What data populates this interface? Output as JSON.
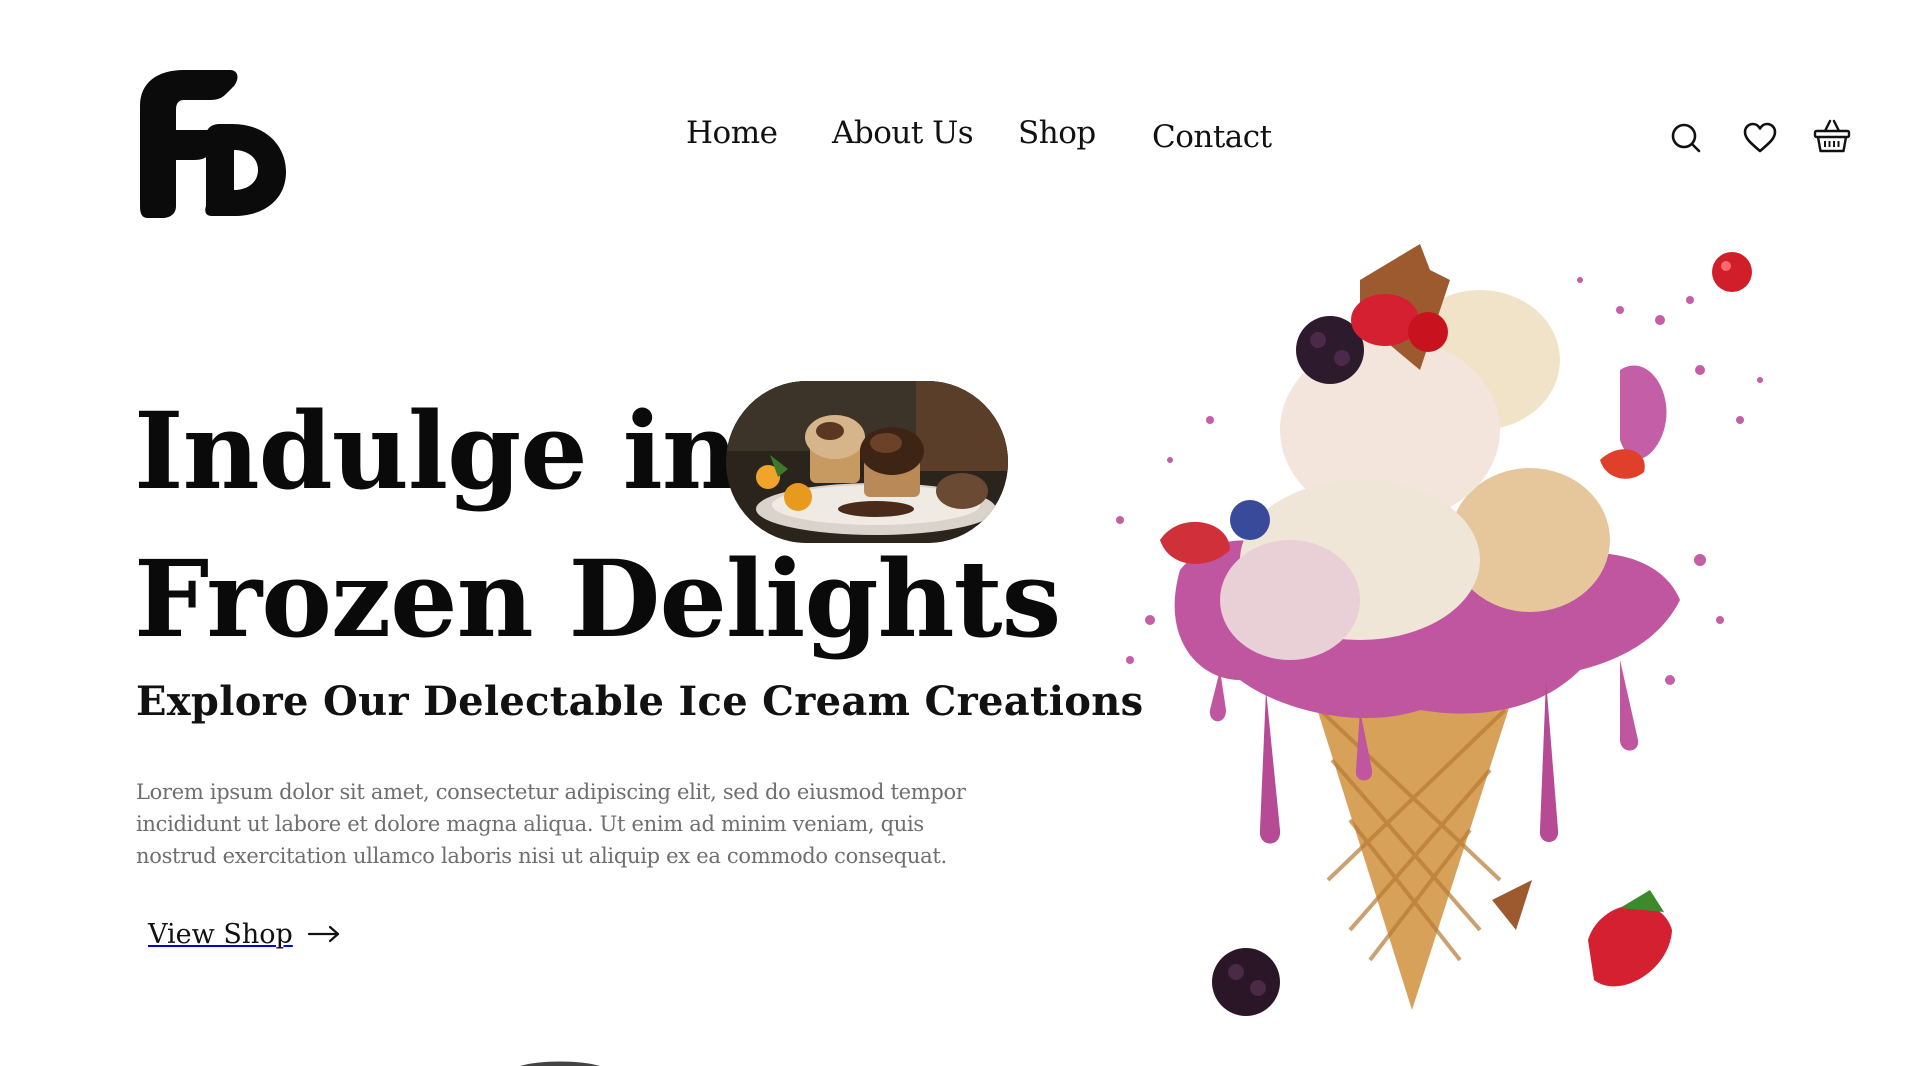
{
  "logo": {
    "icon": "fd-monogram-logo"
  },
  "nav": {
    "items": [
      {
        "label": "Home"
      },
      {
        "label": "About Us"
      },
      {
        "label": "Shop"
      },
      {
        "label": "Contact"
      }
    ]
  },
  "header_icons": [
    "search-icon",
    "heart-icon",
    "basket-icon"
  ],
  "hero": {
    "headline_line1": "Indulge in",
    "headline_line2": "Frozen Delights",
    "subtitle": "Explore Our Delectable Ice Cream Creations",
    "body": "Lorem ipsum dolor sit amet, consectetur adipiscing elit, sed do eiusmod tempor incididunt ut labore et dolore magna aliqua. Ut enim ad minim veniam, quis nostrud exercitation ullamco laboris nisi ut aliquip ex ea commodo consequat.",
    "cta_label": "View Shop",
    "cta_icon": "arrow-right-icon"
  },
  "colors": {
    "text": "#111111",
    "body_text": "#6e6e6e",
    "background": "#ffffff",
    "accent_berry": "#c0509a"
  }
}
